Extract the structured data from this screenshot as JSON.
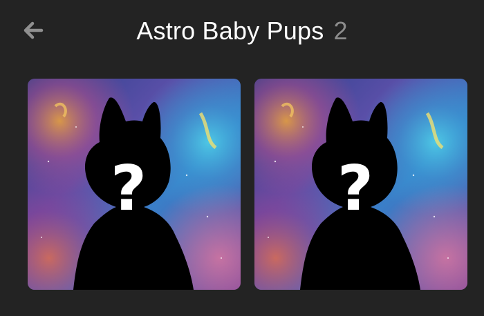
{
  "header": {
    "back_icon": "arrow-left-icon",
    "title": "Astro Baby Pups",
    "count": "2"
  },
  "cards": [
    {
      "image": "mystery-pup-silhouette",
      "icon": "question-mark-icon",
      "accent": "#4aa3d8"
    },
    {
      "image": "mystery-pup-silhouette",
      "icon": "question-mark-icon",
      "accent": "#4aa3d8"
    }
  ],
  "colors": {
    "background": "#232323",
    "title": "#ffffff",
    "count": "#8c8c8c",
    "back_icon": "#8f8f8f"
  }
}
